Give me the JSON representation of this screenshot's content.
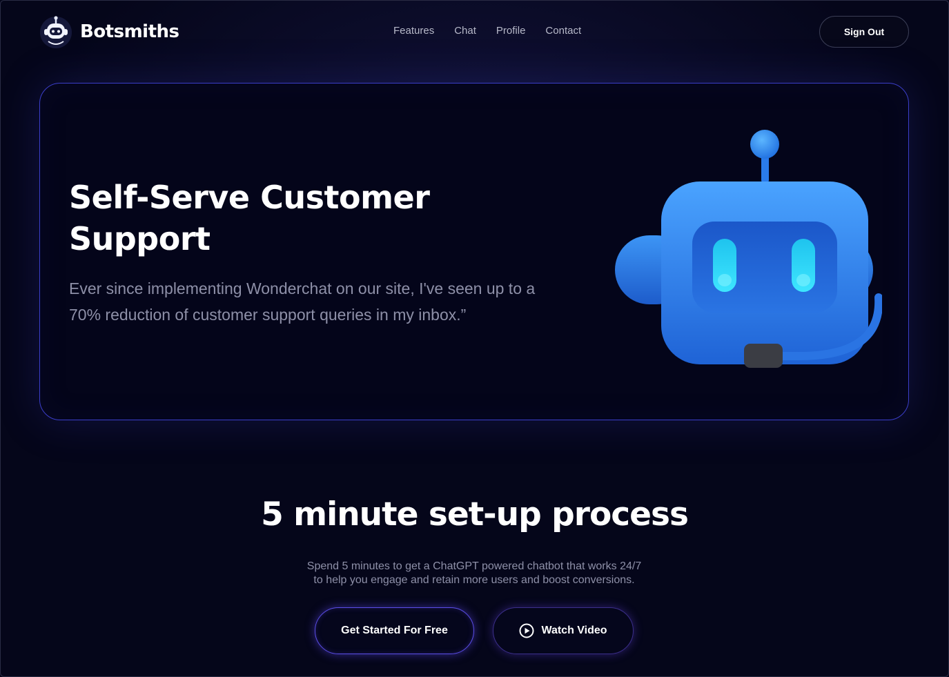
{
  "header": {
    "brand_name": "Botsmiths",
    "logo_icon": "robot-head-icon",
    "nav": [
      "Features",
      "Chat",
      "Profile",
      "Contact"
    ],
    "sign_out_label": "Sign Out"
  },
  "hero": {
    "title_line1": "Self-Serve Customer",
    "title_line2": "Support",
    "quote": "Ever since implementing Wonderchat on our site, I've seen up to a 70% reduction of customer support queries in my inbox.”",
    "illustration_icon": "robot-headset-icon"
  },
  "setup": {
    "title": "5 minute set-up process",
    "subtitle_line1": "Spend 5 minutes to get a ChatGPT powered chatbot that works 24/7",
    "subtitle_line2": "to help you engage and retain more users and boost conversions.",
    "primary_button": "Get Started For Free",
    "secondary_button": "Watch Video",
    "secondary_icon": "play-circle-icon"
  },
  "colors": {
    "background": "#05061a",
    "accent": "#3b3ec9",
    "robot_blue": "#2f7fe6",
    "robot_eyes": "#1fd6f0"
  }
}
